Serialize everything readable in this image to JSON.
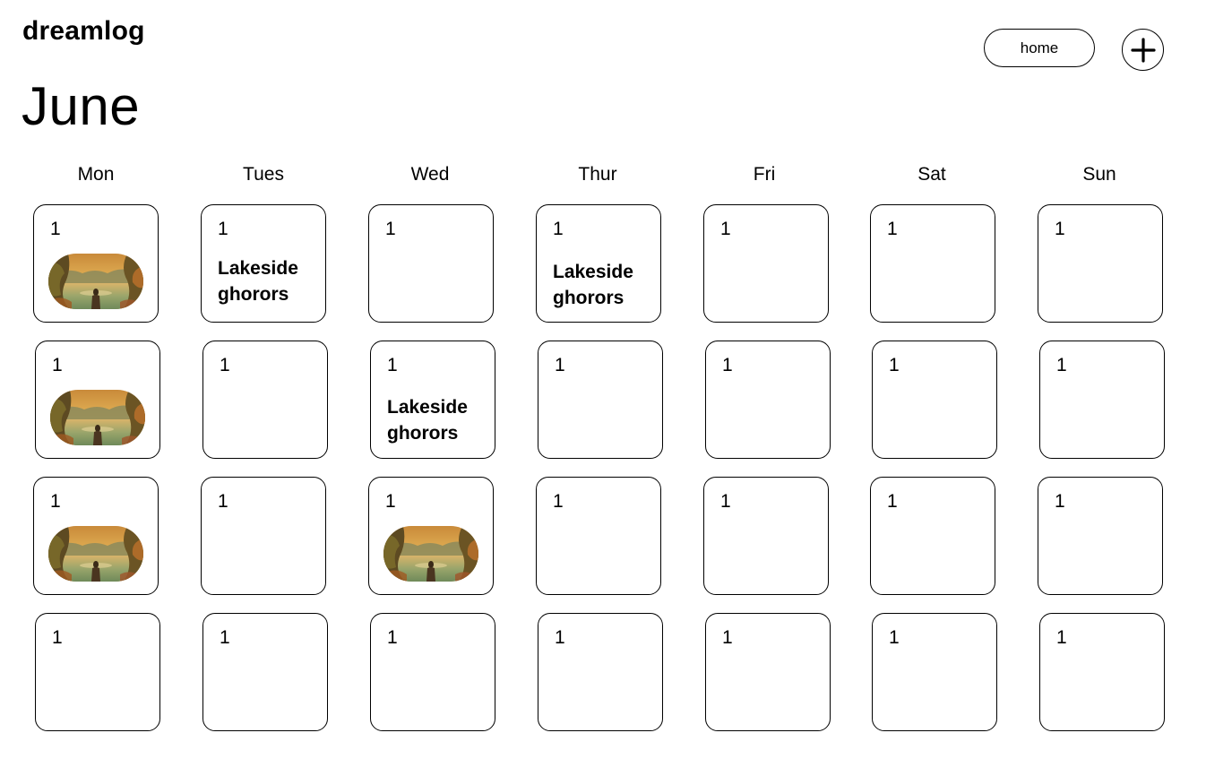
{
  "app": {
    "brand": "dreamlog"
  },
  "header": {
    "month": "June",
    "home_label": "home",
    "add_icon": "plus-icon"
  },
  "weekdays": [
    "Mon",
    "Tues",
    "Wed",
    "Thur",
    "Fri",
    "Sat",
    "Sun"
  ],
  "weeks": [
    [
      {
        "day": "1",
        "entry": "image"
      },
      {
        "day": "1",
        "entry": "title",
        "title": "Lakeside ghorors"
      },
      {
        "day": "1",
        "entry": "none"
      },
      {
        "day": "1",
        "entry": "title",
        "title": "Lakeside ghorors"
      },
      {
        "day": "1",
        "entry": "none"
      },
      {
        "day": "1",
        "entry": "none"
      },
      {
        "day": "1",
        "entry": "none"
      }
    ],
    [
      {
        "day": "1",
        "entry": "image"
      },
      {
        "day": "1",
        "entry": "none"
      },
      {
        "day": "1",
        "entry": "title",
        "title": "Lakeside ghorors"
      },
      {
        "day": "1",
        "entry": "none"
      },
      {
        "day": "1",
        "entry": "none"
      },
      {
        "day": "1",
        "entry": "none"
      },
      {
        "day": "1",
        "entry": "none"
      }
    ],
    [
      {
        "day": "1",
        "entry": "image"
      },
      {
        "day": "1",
        "entry": "none"
      },
      {
        "day": "1",
        "entry": "image"
      },
      {
        "day": "1",
        "entry": "none"
      },
      {
        "day": "1",
        "entry": "none"
      },
      {
        "day": "1",
        "entry": "none"
      },
      {
        "day": "1",
        "entry": "none"
      }
    ],
    [
      {
        "day": "1",
        "entry": "none"
      },
      {
        "day": "1",
        "entry": "none"
      },
      {
        "day": "1",
        "entry": "none"
      },
      {
        "day": "1",
        "entry": "none"
      },
      {
        "day": "1",
        "entry": "none"
      },
      {
        "day": "1",
        "entry": "none"
      },
      {
        "day": "1",
        "entry": "none"
      }
    ]
  ]
}
